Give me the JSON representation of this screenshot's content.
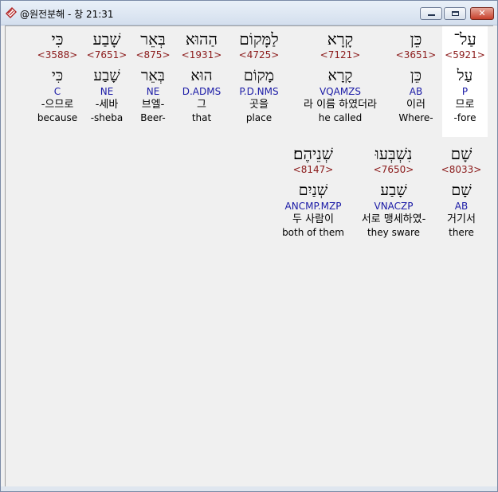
{
  "window": {
    "title": "@원전분해 - 창 21:31",
    "min_glyph": "",
    "max_glyph": "",
    "close_glyph": "✕"
  },
  "rows": [
    {
      "words": [
        {
          "hebrew": "עַל־",
          "strongs": "<5921>",
          "lemma": "עַל",
          "parsing": "P",
          "korean": "므로",
          "english": "-fore",
          "highlight": true
        },
        {
          "hebrew": "כֵּן",
          "strongs": "<3651>",
          "lemma": "כֵּן",
          "parsing": "AB",
          "korean": "이러",
          "english": "Where-",
          "highlight": false
        },
        {
          "hebrew": "קָרָא",
          "strongs": "<7121>",
          "lemma": "קָרָא",
          "parsing": "VQAMZS",
          "korean": "라 이름 하였더라",
          "english": "he called",
          "highlight": false
        },
        {
          "hebrew": "לַמָּקוֹם",
          "strongs": "<4725>",
          "lemma": "מָקוֹם",
          "parsing": "P.D.NMS",
          "korean": "곳을",
          "english": "place",
          "highlight": false
        },
        {
          "hebrew": "הַהוּא",
          "strongs": "<1931>",
          "lemma": "הוּא",
          "parsing": "D.ADMS",
          "korean": "그",
          "english": "that",
          "highlight": false
        },
        {
          "hebrew": "בְּאֵר",
          "strongs": "<875>",
          "lemma": "בְּאֵר",
          "parsing": "NE",
          "korean": "브엘-",
          "english": "Beer-",
          "highlight": false
        },
        {
          "hebrew": "שָׁבַע",
          "strongs": "<7651>",
          "lemma": "שָׁבַע",
          "parsing": "NE",
          "korean": "-세바",
          "english": "-sheba",
          "highlight": false
        },
        {
          "hebrew": "כִּי",
          "strongs": "<3588>",
          "lemma": "כִּי",
          "parsing": "C",
          "korean": "-으므로",
          "english": "because",
          "highlight": false
        }
      ]
    },
    {
      "words": [
        {
          "hebrew": "שָׁם",
          "strongs": "<8033>",
          "lemma": "שָׁם",
          "parsing": "AB",
          "korean": "거기서",
          "english": "there",
          "highlight": false
        },
        {
          "hebrew": "נִשְׁבְּעוּ",
          "strongs": "<7650>",
          "lemma": "שָׁבַע",
          "parsing": "VNACZP",
          "korean": "서로 맹세하였-",
          "english": "they sware",
          "highlight": false
        },
        {
          "hebrew": "שְׁנֵיהֶם׃",
          "strongs": "<8147>",
          "lemma": "שְׁנַיִם",
          "parsing": "ANCMP.MZP",
          "korean": "두 사람이",
          "english": "both of them",
          "highlight": false
        }
      ]
    }
  ]
}
